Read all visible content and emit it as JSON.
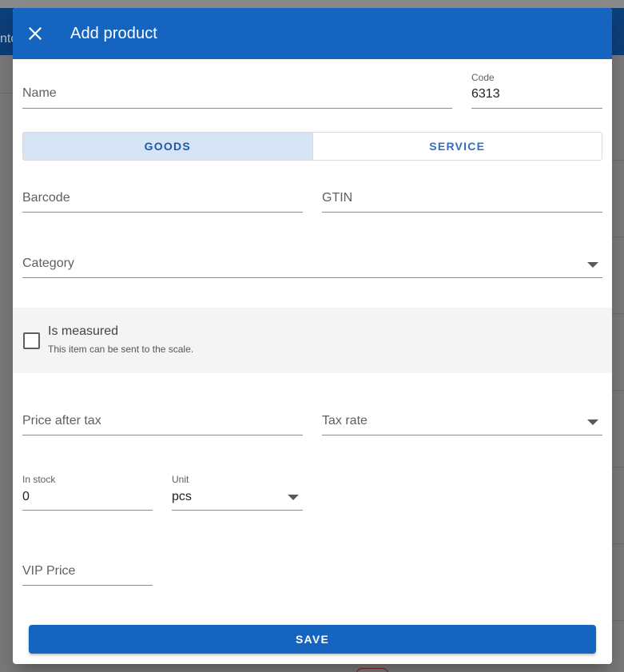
{
  "background": {
    "appbar_text": "nto"
  },
  "dialog": {
    "title": "Add product",
    "close_icon": "close-icon"
  },
  "form": {
    "name": {
      "placeholder": "Name"
    },
    "code": {
      "label": "Code",
      "value": "6313"
    },
    "type_toggle": {
      "options": [
        "GOODS",
        "SERVICE"
      ],
      "selected": "GOODS"
    },
    "barcode": {
      "placeholder": "Barcode"
    },
    "gtin": {
      "placeholder": "GTIN"
    },
    "category": {
      "placeholder": "Category",
      "icon": "chevron-down-icon"
    },
    "measured": {
      "label": "Is measured",
      "hint": "This item can be sent to the scale.",
      "checked": false
    },
    "price_after_tax": {
      "placeholder": "Price after tax"
    },
    "tax_rate": {
      "placeholder": "Tax rate",
      "icon": "chevron-down-icon"
    },
    "in_stock": {
      "label": "In stock",
      "value": "0"
    },
    "unit": {
      "label": "Unit",
      "value": "pcs",
      "icon": "chevron-down-icon"
    },
    "vip_price": {
      "placeholder": "VIP Price"
    }
  },
  "actions": {
    "save_label": "SAVE"
  },
  "colors": {
    "primary": "#1565c0",
    "toggle_active_bg": "#d6e4f6",
    "section_bg": "#f4f4f4"
  }
}
